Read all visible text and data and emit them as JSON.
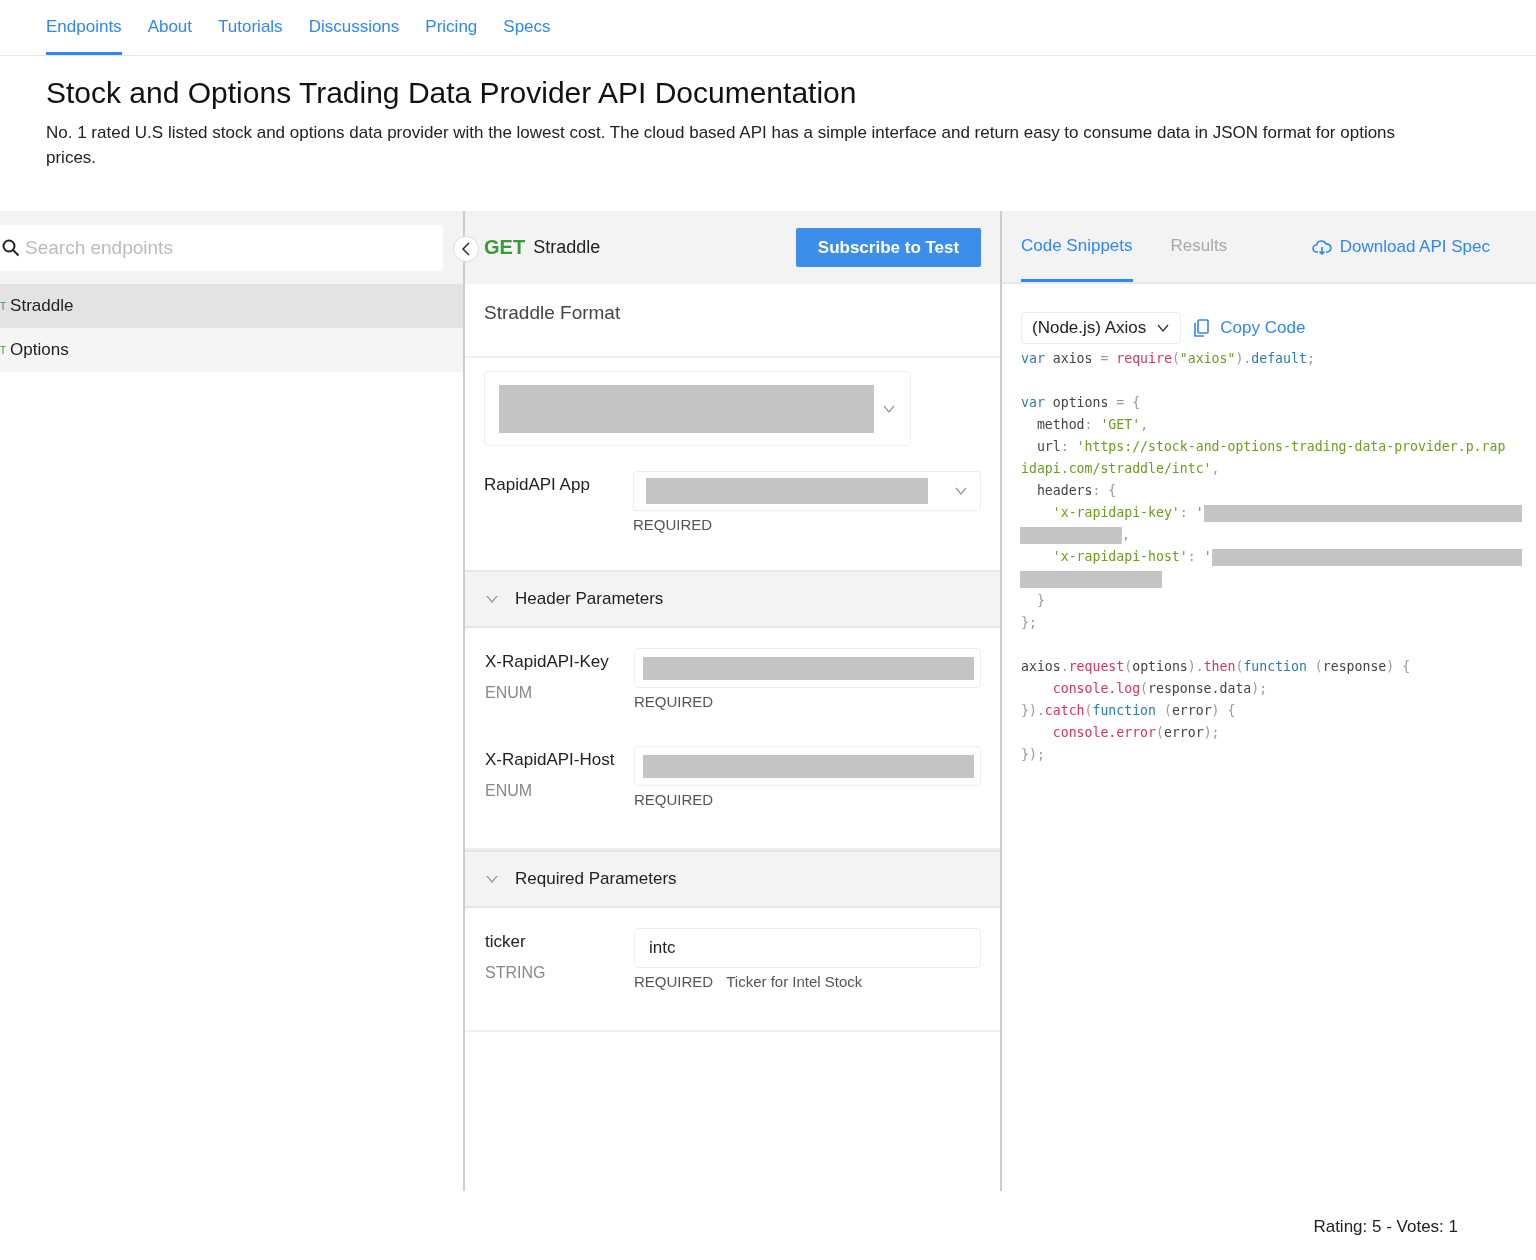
{
  "nav": {
    "tabs": [
      {
        "label": "Endpoints",
        "selected": true
      },
      {
        "label": "About",
        "selected": false
      },
      {
        "label": "Tutorials",
        "selected": false
      },
      {
        "label": "Discussions",
        "selected": false
      },
      {
        "label": "Pricing",
        "selected": false
      },
      {
        "label": "Specs",
        "selected": false
      }
    ]
  },
  "title": "Stock and Options Trading Data Provider API Documentation",
  "description": "No. 1 rated U.S listed stock and options data provider with the lowest cost. The cloud based API has a simple interface and return easy to consume data in JSON format for options prices.",
  "sidebar": {
    "search": {
      "placeholder": "Search endpoints"
    },
    "items": [
      {
        "method": "T",
        "label": "Straddle",
        "selected": true
      },
      {
        "method": "T",
        "label": "Options",
        "selected": false
      }
    ]
  },
  "endpoint": {
    "method": "GET",
    "name": "Straddle",
    "subscribe_button": "Subscribe to Test",
    "format_title": "Straddle Format",
    "format_select": {
      "redacted": true
    },
    "app": {
      "label": "RapidAPI App",
      "redacted": true,
      "note": "REQUIRED"
    },
    "sections": [
      {
        "title": "Header Parameters",
        "expanded": true,
        "params": [
          {
            "name": "X-RapidAPI-Key",
            "type": "ENUM",
            "redacted": true,
            "note": "REQUIRED"
          },
          {
            "name": "X-RapidAPI-Host",
            "type": "ENUM",
            "redacted": true,
            "note": "REQUIRED"
          }
        ]
      },
      {
        "title": "Required Parameters",
        "expanded": true,
        "params": [
          {
            "name": "ticker",
            "type": "STRING",
            "redacted": false,
            "value": "intc",
            "note": "REQUIRED",
            "description": "Ticker for Intel Stock"
          }
        ]
      }
    ]
  },
  "code_panel": {
    "tabs": [
      {
        "label": "Code Snippets",
        "selected": true,
        "disabled": false
      },
      {
        "label": "Results",
        "selected": false,
        "disabled": true
      }
    ],
    "download_link": "Download API Spec",
    "language_select": "(Node.js) Axios",
    "copy_button": "Copy Code",
    "blocks": [
      [
        [
          {
            "kind": "kw",
            "text": "var"
          },
          {
            "kind": "plain",
            "text": " axios "
          },
          {
            "kind": "punct",
            "text": "= "
          },
          {
            "kind": "fn",
            "text": "require"
          },
          {
            "kind": "punct",
            "text": "("
          },
          {
            "kind": "str",
            "text": "\"axios\""
          },
          {
            "kind": "punct",
            "text": ")."
          },
          {
            "kind": "kw",
            "text": "default"
          },
          {
            "kind": "punct",
            "text": ";"
          }
        ]
      ],
      [
        [
          {
            "kind": "kw",
            "text": "var"
          },
          {
            "kind": "plain",
            "text": " options "
          },
          {
            "kind": "punct",
            "text": "= {"
          }
        ],
        [
          {
            "kind": "plain",
            "text": "  method"
          },
          {
            "kind": "punct",
            "text": ": "
          },
          {
            "kind": "str",
            "text": "'GET'"
          },
          {
            "kind": "punct",
            "text": ","
          }
        ],
        [
          {
            "kind": "plain",
            "text": "  url"
          },
          {
            "kind": "punct",
            "text": ": "
          },
          {
            "kind": "str",
            "text": "'https://stock-and-options-trading-data-provider.p.rap"
          }
        ],
        [
          {
            "kind": "str",
            "text": "idapi.com/straddle/intc'"
          },
          {
            "kind": "punct",
            "text": ","
          }
        ],
        [
          {
            "kind": "plain",
            "text": "  headers"
          },
          {
            "kind": "punct",
            "text": ": {"
          }
        ],
        [
          {
            "kind": "str",
            "text": "    'x-rapidapi-key'"
          },
          {
            "kind": "punct",
            "text": ": "
          },
          {
            "kind": "str",
            "text": "'"
          },
          {
            "kind": "redaction-rest"
          }
        ],
        [
          {
            "kind": "redaction-short"
          },
          {
            "kind": "punct",
            "text": ","
          }
        ],
        [
          {
            "kind": "str",
            "text": "    'x-rapidapi-host'"
          },
          {
            "kind": "punct",
            "text": ": "
          },
          {
            "kind": "str",
            "text": "'"
          },
          {
            "kind": "redaction-rest"
          }
        ],
        [
          {
            "kind": "redaction-medium"
          }
        ],
        [
          {
            "kind": "punct",
            "text": "  }"
          }
        ],
        [
          {
            "kind": "punct",
            "text": "};"
          }
        ]
      ],
      [
        [
          {
            "kind": "plain",
            "text": "axios"
          },
          {
            "kind": "punct",
            "text": "."
          },
          {
            "kind": "fn",
            "text": "request"
          },
          {
            "kind": "punct",
            "text": "("
          },
          {
            "kind": "plain",
            "text": "options"
          },
          {
            "kind": "punct",
            "text": ")."
          },
          {
            "kind": "fn",
            "text": "then"
          },
          {
            "kind": "punct",
            "text": "("
          },
          {
            "kind": "kw",
            "text": "function"
          },
          {
            "kind": "punct",
            "text": " ("
          },
          {
            "kind": "plain",
            "text": "response"
          },
          {
            "kind": "punct",
            "text": ") {"
          }
        ],
        [
          {
            "kind": "fn",
            "text": "    console.log"
          },
          {
            "kind": "punct",
            "text": "("
          },
          {
            "kind": "plain",
            "text": "response.data"
          },
          {
            "kind": "punct",
            "text": ");"
          }
        ],
        [
          {
            "kind": "punct",
            "text": "})."
          },
          {
            "kind": "fn",
            "text": "catch"
          },
          {
            "kind": "punct",
            "text": "("
          },
          {
            "kind": "kw",
            "text": "function"
          },
          {
            "kind": "punct",
            "text": " ("
          },
          {
            "kind": "plain",
            "text": "error"
          },
          {
            "kind": "punct",
            "text": ") {"
          }
        ],
        [
          {
            "kind": "fn",
            "text": "    console.error"
          },
          {
            "kind": "punct",
            "text": "("
          },
          {
            "kind": "plain",
            "text": "error"
          },
          {
            "kind": "punct",
            "text": ");"
          }
        ],
        [
          {
            "kind": "punct",
            "text": "});"
          }
        ]
      ]
    ]
  },
  "footer": {
    "rating": "Rating: 5 - Votes: 1"
  }
}
